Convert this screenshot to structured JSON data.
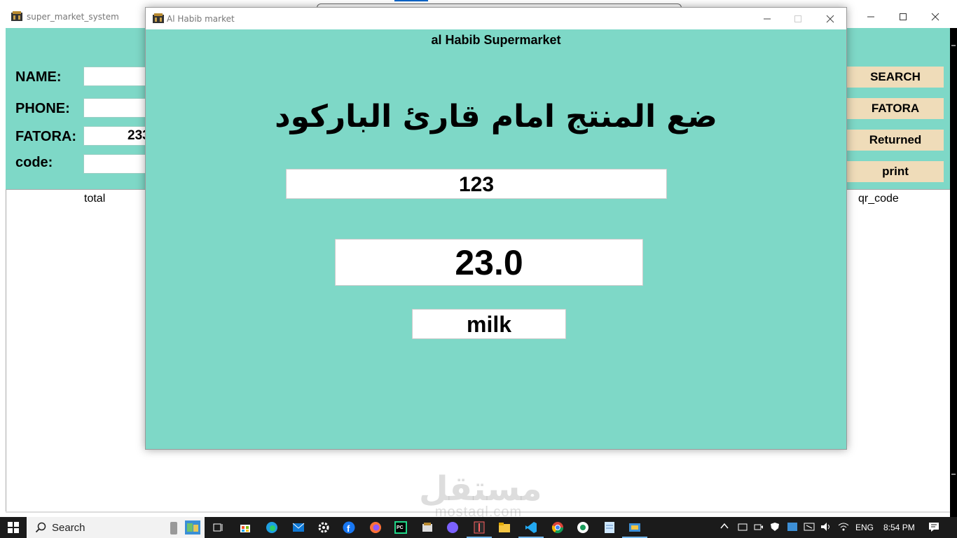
{
  "background_window": {
    "title": "super_market_system",
    "form": {
      "name_label": "NAME:",
      "name_value": "",
      "phone_label": "PHONE:",
      "phone_value": "",
      "fatora_label": "FATORA:",
      "fatora_value": "233",
      "code_label": "code:",
      "code_value": ""
    },
    "buttons": {
      "search": "SEARCH",
      "fatora": "FATORA",
      "returned": "Returned",
      "print": "print"
    },
    "table": {
      "columns": [
        "total",
        "qr_code"
      ]
    }
  },
  "popup_window": {
    "title": "Al Habib market",
    "header": "al Habib Supermarket",
    "instruction": "ضع المنتج امام قارئ الباركود",
    "barcode_value": "123",
    "price_value": "23.0",
    "product_name": "milk"
  },
  "watermark": {
    "arabic": "مستقل",
    "latin": "mostaql.com"
  },
  "taskbar": {
    "search_label": "Search",
    "language": "ENG",
    "time": "8:54 PM"
  },
  "colors": {
    "form_background": "#7ed8c7",
    "button_background": "#efdcb9",
    "taskbar": "#1b1b1b"
  }
}
